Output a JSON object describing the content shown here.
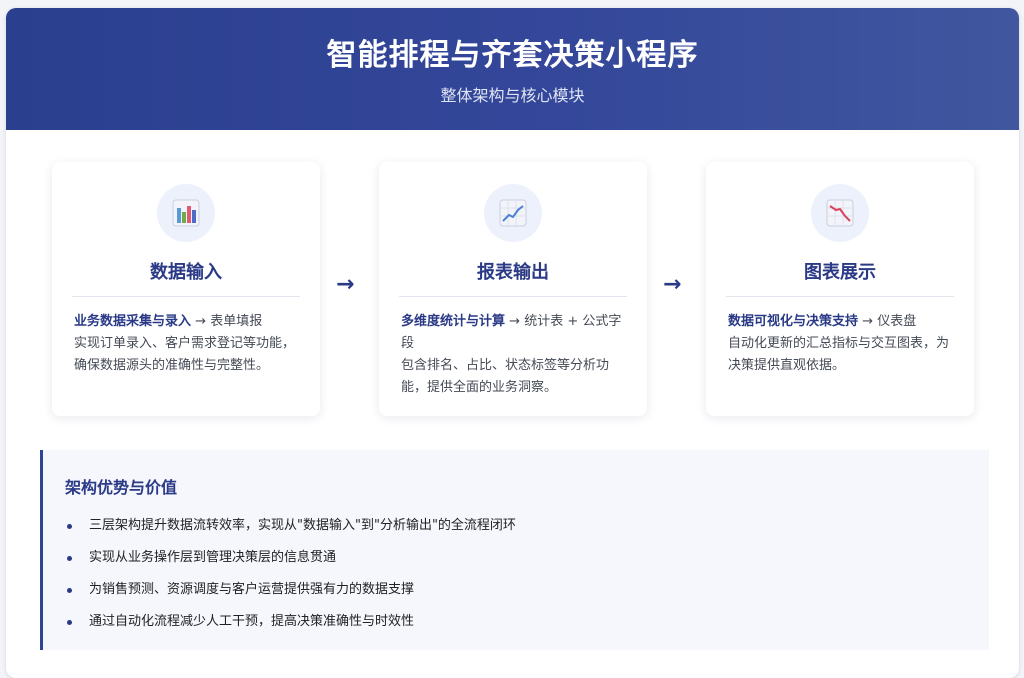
{
  "header": {
    "title": "智能排程与齐套决策小程序",
    "subtitle": "整体架构与核心模块"
  },
  "cards": [
    {
      "icon": "bar-chart-icon",
      "title": "数据输入",
      "lead": "业务数据采集与录入",
      "arrow": " → ",
      "lead_tail": "表单填报",
      "body": "实现订单录入、客户需求登记等功能，确保数据源头的准确性与完整性。"
    },
    {
      "icon": "line-chart-up-icon",
      "title": "报表输出",
      "lead": "多维度统计与计算",
      "arrow": " → ",
      "lead_tail": "统计表 + 公式字段",
      "body": "包含排名、占比、状态标签等分析功能，提供全面的业务洞察。"
    },
    {
      "icon": "line-chart-down-icon",
      "title": "图表展示",
      "lead": "数据可视化与决策支持",
      "arrow": " → ",
      "lead_tail": "仪表盘",
      "body": "自动化更新的汇总指标与交互图表，为决策提供直观依据。"
    }
  ],
  "flow_arrows": [
    "→",
    "→"
  ],
  "advantages": {
    "title": "架构优势与价值",
    "items": [
      "三层架构提升数据流转效率，实现从\"数据输入\"到\"分析输出\"的全流程闭环",
      "实现从业务操作层到管理决策层的信息贯通",
      "为销售预测、资源调度与客户运营提供强有力的数据支撑",
      "通过自动化流程减少人工干预，提高决策准确性与时效性"
    ]
  },
  "colors": {
    "header_start": "#2b3f8f",
    "header_end": "#40579f",
    "accent": "#2a3a86",
    "panel_bg": "#f5f7fc"
  }
}
